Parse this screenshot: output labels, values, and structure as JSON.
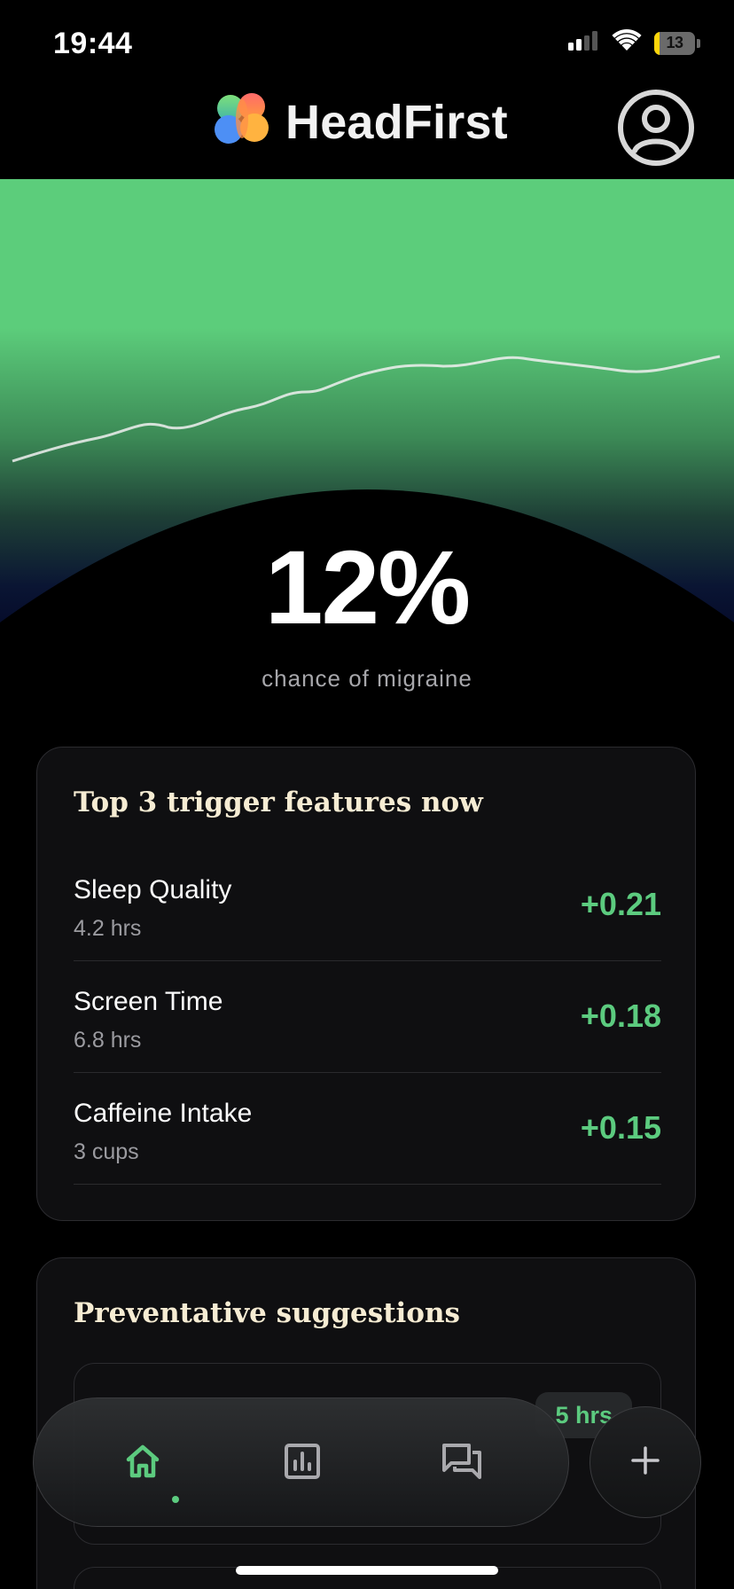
{
  "status_bar": {
    "time": "19:44",
    "battery_text": "13",
    "battery_level": 0.13,
    "icons": [
      "signal-icon",
      "wifi-icon",
      "battery-icon"
    ]
  },
  "header": {
    "app_title": "HeadFirst",
    "logo_icon": "brain-logo-icon",
    "profile_icon": "profile-icon"
  },
  "risk": {
    "value": "12%",
    "label": "chance of migraine"
  },
  "triggers": {
    "title": "Top 3 trigger features now",
    "items": [
      {
        "name": "Sleep Quality",
        "detail": "4.2 hrs",
        "score": "+0.21"
      },
      {
        "name": "Screen Time",
        "detail": "6.8 hrs",
        "score": "+0.18"
      },
      {
        "name": "Caffeine Intake",
        "detail": "3 cups",
        "score": "+0.15"
      }
    ]
  },
  "suggestions": {
    "title": "Preventative suggestions",
    "first_item_badge": "5 hrs"
  },
  "tab_bar": {
    "tabs": [
      "home-icon",
      "stats-icon",
      "chat-icon"
    ],
    "active_tab": 0,
    "fab_icon": "plus-icon"
  },
  "colors": {
    "accent": "#5CCB7F",
    "card_background": "#0F0F11",
    "title_cream": "#F6ECD3"
  }
}
